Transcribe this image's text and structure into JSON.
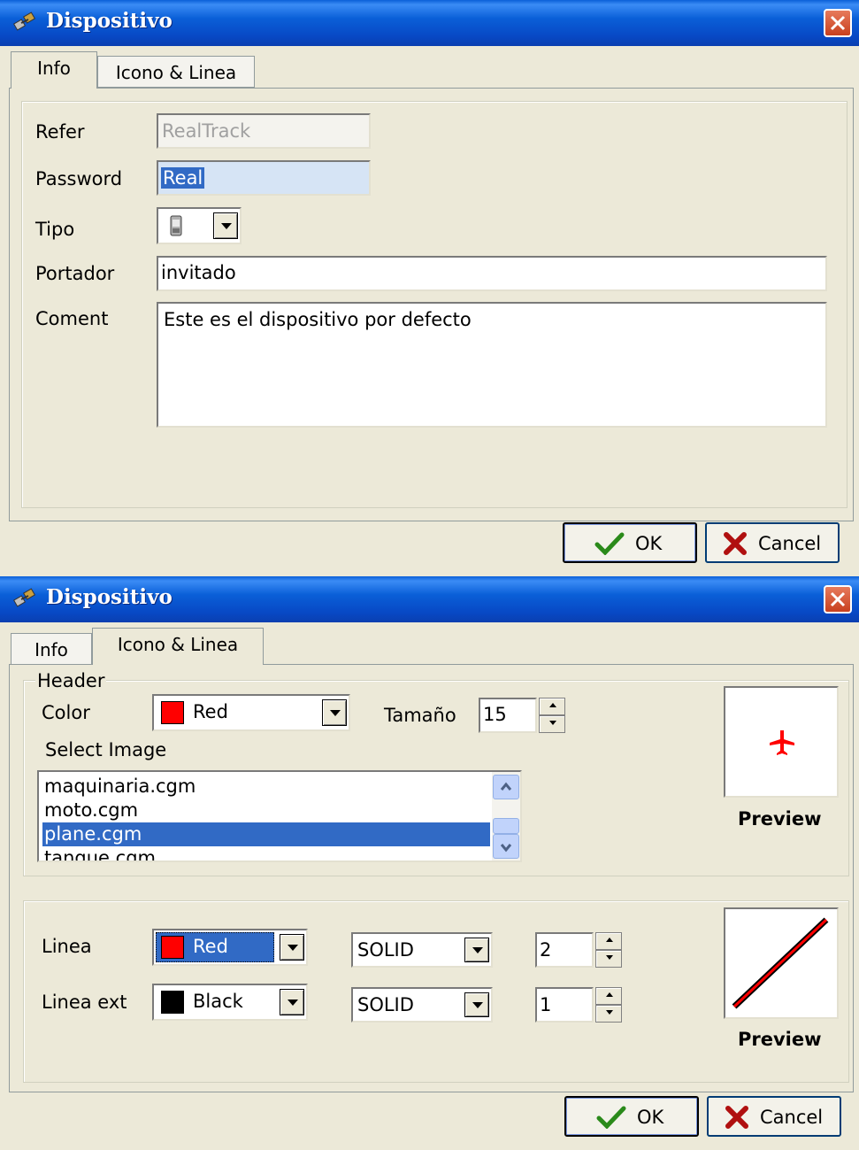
{
  "dialog1": {
    "title": "Dispositivo",
    "tabs": [
      "Info",
      "Icono & Linea"
    ],
    "fields": {
      "refer": {
        "label": "Refer",
        "value": "RealTrack"
      },
      "password": {
        "label": "Password",
        "value": "Real"
      },
      "tipo": {
        "label": "Tipo"
      },
      "portador": {
        "label": "Portador",
        "value": "invitado"
      },
      "coment": {
        "label": "Coment",
        "value": "Este es el dispositivo por defecto"
      }
    },
    "ok_label": "OK",
    "cancel_label": "Cancel"
  },
  "dialog2": {
    "title": "Dispositivo",
    "tabs": [
      "Info",
      "Icono & Linea"
    ],
    "header_group": {
      "legend": "Header",
      "color_label": "Color",
      "color_value": "Red",
      "color_hex": "#ff0000",
      "size_label": "Tamaño",
      "size_value": "15",
      "select_image_label": "Select Image",
      "images": [
        "maquinaria.cgm",
        "moto.cgm",
        "plane.cgm",
        "tanque.cgm"
      ],
      "selected_image": "plane.cgm",
      "preview_label": "Preview"
    },
    "line_group": {
      "linea_label": "Linea",
      "linea_color": "Red",
      "linea_color_hex": "#ff0000",
      "linea_style": "SOLID",
      "linea_width": "2",
      "linea_ext_label": "Linea ext",
      "linea_ext_color": "Black",
      "linea_ext_color_hex": "#000000",
      "linea_ext_style": "SOLID",
      "linea_ext_width": "1",
      "preview_label": "Preview"
    },
    "ok_label": "OK",
    "cancel_label": "Cancel"
  },
  "icons": [
    "satellite-app-icon",
    "close-icon",
    "checkmark-icon",
    "cancel-x-icon",
    "device-type-icon",
    "plane-icon",
    "scroll-up-icon",
    "scroll-down-icon"
  ]
}
